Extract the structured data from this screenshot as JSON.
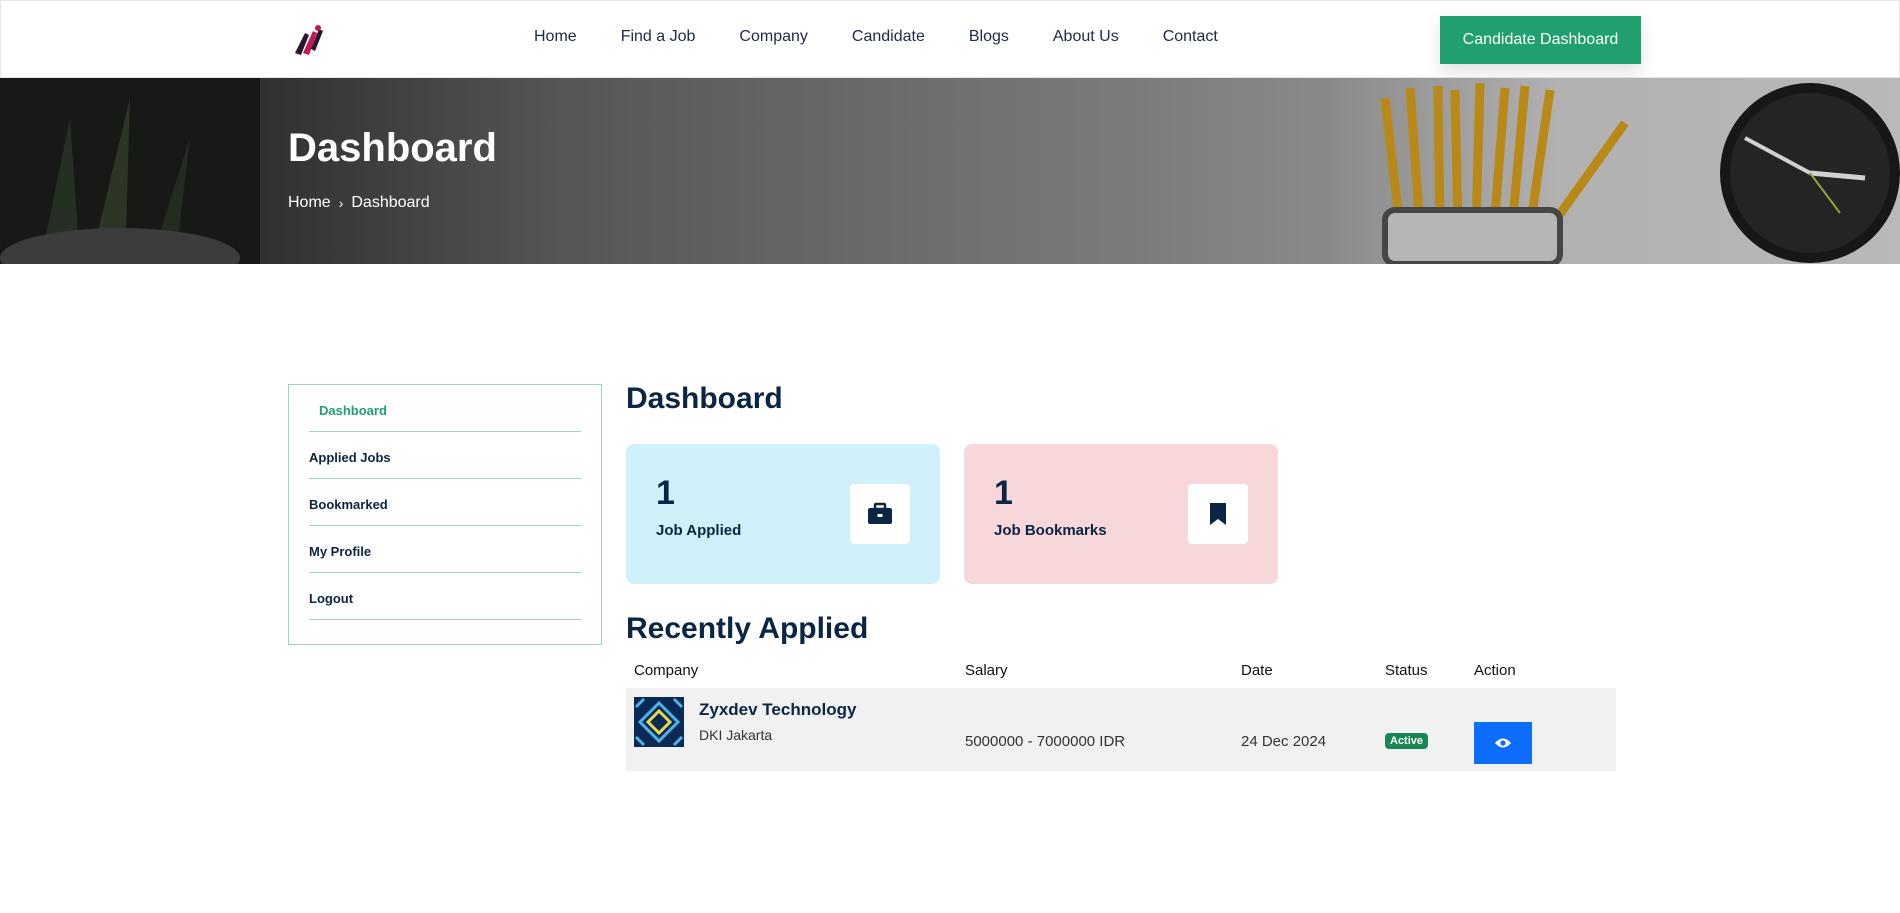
{
  "header": {
    "nav": [
      "Home",
      "Find a Job",
      "Company",
      "Candidate",
      "Blogs",
      "About Us",
      "Contact"
    ],
    "cta_label": "Candidate Dashboard"
  },
  "banner": {
    "title": "Dashboard",
    "breadcrumb": {
      "home": "Home",
      "current": "Dashboard"
    }
  },
  "sidebar": {
    "items": [
      {
        "label": "Dashboard",
        "active": true
      },
      {
        "label": "Applied Jobs"
      },
      {
        "label": "Bookmarked"
      },
      {
        "label": "My Profile"
      },
      {
        "label": "Logout"
      }
    ]
  },
  "main": {
    "title": "Dashboard",
    "stats": [
      {
        "value": "1",
        "label": "Job Applied",
        "icon": "briefcase-icon",
        "color": "#d0f1f9"
      },
      {
        "value": "1",
        "label": "Job Bookmarks",
        "icon": "bookmark-icon",
        "color": "#f8d7db"
      }
    ],
    "recent_title": "Recently Applied",
    "table": {
      "headers": [
        "Company",
        "Salary",
        "Date",
        "Status",
        "Action"
      ],
      "rows": [
        {
          "company": "Zyxdev Technology",
          "location": "DKI Jakarta",
          "salary": "5000000 - 7000000 IDR",
          "date": "24 Dec 2024",
          "status": "Active"
        }
      ]
    }
  },
  "colors": {
    "accent": "#1fa06e",
    "primary": "#0d6efd",
    "navy": "#0b2545"
  }
}
